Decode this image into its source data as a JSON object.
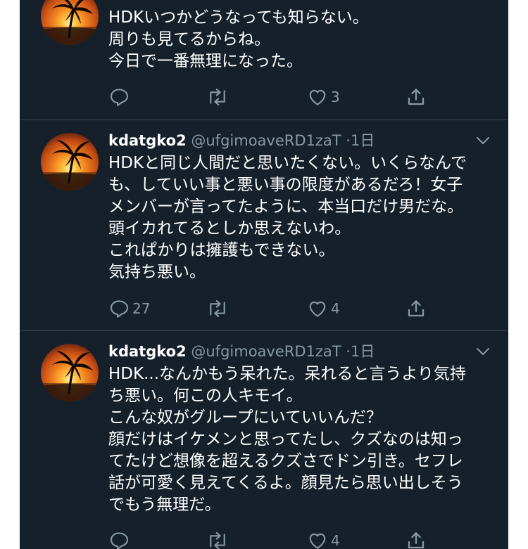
{
  "tweets": [
    {
      "name": "",
      "handle": "",
      "time": "",
      "lines": [
        "HDKいつかどうなっても知らない。",
        "周りも見てるからね。",
        "今日で一番無理になった。"
      ],
      "replies": "",
      "likes": "3"
    },
    {
      "name": "kdatgko2",
      "handle": "@ufgimoaveRD1zaT",
      "time": "1日",
      "lines": [
        "HDKと同じ人間だと思いたくない。いくらなんで",
        "も、していい事と悪い事の限度があるだろ！女子",
        "メンバーが言ってたように、本当口だけ男だな。",
        "頭イカれてるとしか思えないわ。",
        "これぱかりは擁護もできない。",
        "気持ち悪い。"
      ],
      "replies": "27",
      "likes": "4"
    },
    {
      "name": "kdatgko2",
      "handle": "@ufgimoaveRD1zaT",
      "time": "1日",
      "lines": [
        "HDK...なんかもう呆れた。呆れると言うより気持",
        "ち悪い。何この人キモイ。",
        "こんな奴がグループにいていいんだ？",
        "顔だけはイケメンと思ってたし、クズなのは知っ",
        "てたけど想像を超えるクズさでドン引き。セフレ",
        "話が可愛く見えてくるよ。顔見たら思い出しそう",
        "でもう無理だ。"
      ],
      "replies": "",
      "likes": "4"
    }
  ],
  "separator": "·",
  "icons": {
    "avatar": "palm-tree-sunset-avatar",
    "caret": "chevron-down-icon",
    "reply": "reply-icon",
    "retweet": "retweet-icon",
    "like": "heart-icon",
    "share": "share-icon"
  },
  "colors": {
    "background": "#15202b",
    "text": "#ffffff",
    "muted": "#8899a6",
    "divider": "#38444d"
  }
}
